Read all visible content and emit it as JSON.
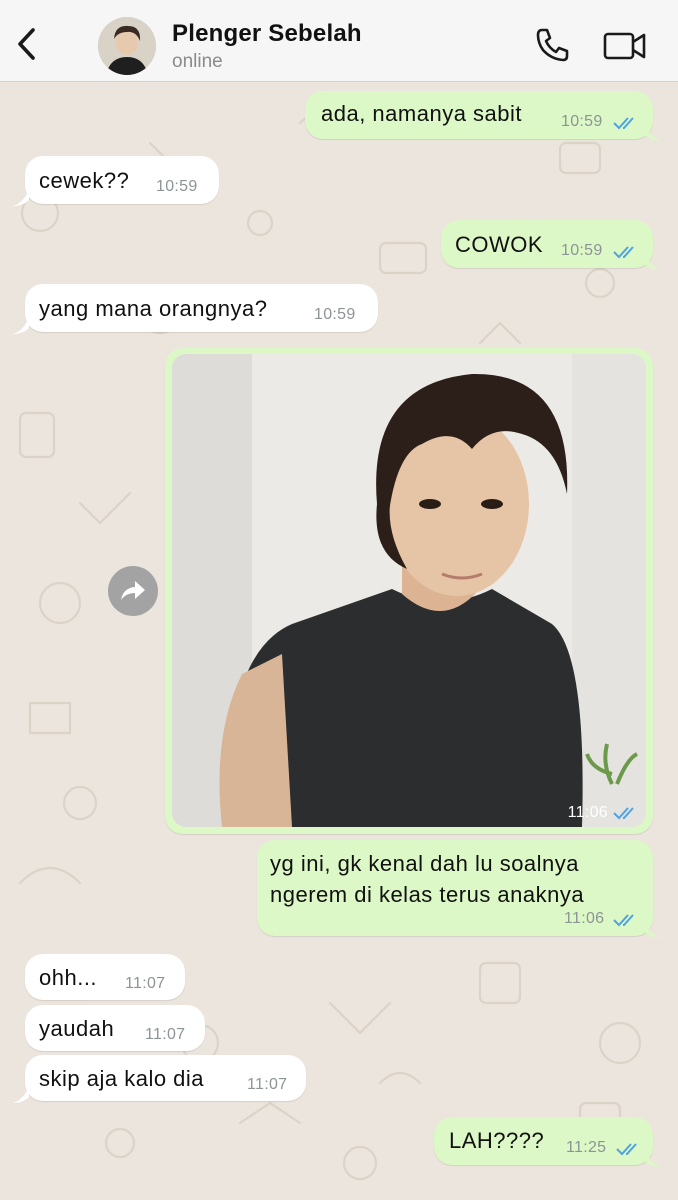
{
  "header": {
    "name": "Plenger Sebelah",
    "status": "online",
    "back_icon": "chevron-left-icon",
    "call_icon": "phone-icon",
    "video_icon": "video-camera-icon"
  },
  "messages": [
    {
      "dir": "out",
      "text": "ada, namanya sabit",
      "time": "10:59",
      "read": true
    },
    {
      "dir": "in",
      "text": "cewek??",
      "time": "10:59"
    },
    {
      "dir": "out",
      "text": "COWOK",
      "time": "10:59",
      "read": true
    },
    {
      "dir": "in",
      "text": "yang mana orangnya?",
      "time": "10:59"
    },
    {
      "dir": "out",
      "type": "photo",
      "time": "11:06",
      "read": true,
      "description_icon": "photo-of-person"
    },
    {
      "dir": "out",
      "text_line1": "yg ini, gk kenal dah lu soalnya",
      "text_line2": "ngerem di kelas terus anaknya",
      "time": "11:06",
      "read": true
    },
    {
      "dir": "in",
      "text": "ohh...",
      "time": "11:07"
    },
    {
      "dir": "in",
      "text": "yaudah",
      "time": "11:07"
    },
    {
      "dir": "in",
      "text": "skip aja kalo dia",
      "time": "11:07"
    },
    {
      "dir": "out",
      "text": "LAH????",
      "time": "11:25",
      "read": true
    }
  ],
  "colors": {
    "chat_bg": "#ece5dd",
    "incoming_bubble": "#ffffff",
    "outgoing_bubble": "#dcf8c6",
    "read_ticks": "#4fa3e0"
  }
}
